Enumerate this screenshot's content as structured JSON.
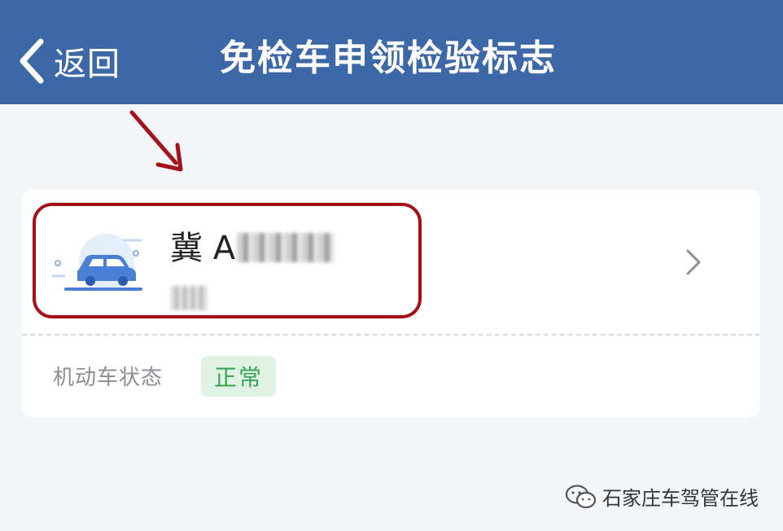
{
  "header": {
    "back_label": "返回",
    "title": "免检车申领检验标志",
    "background_color": "#3c68a8"
  },
  "vehicle": {
    "plate_visible": "冀 A",
    "icon": "car-icon"
  },
  "status": {
    "label": "机动车状态",
    "value": "正常",
    "badge_color": "#3aa356"
  },
  "watermark": {
    "text": "石家庄车驾管在线",
    "icon": "wechat-icon"
  },
  "annotation": {
    "color": "#a31119"
  }
}
